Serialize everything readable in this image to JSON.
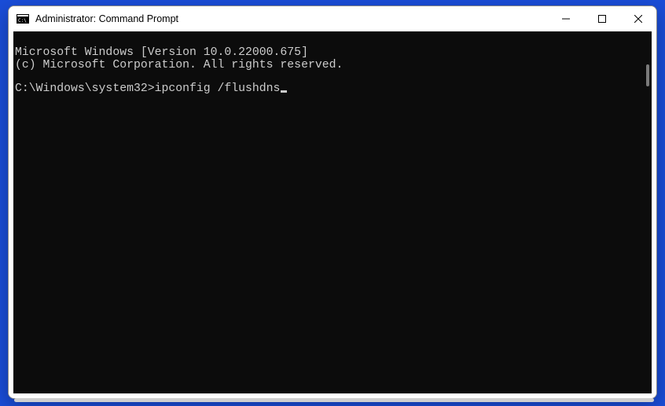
{
  "window": {
    "title": "Administrator: Command Prompt"
  },
  "terminal": {
    "line1": "Microsoft Windows [Version 10.0.22000.675]",
    "line2": "(c) Microsoft Corporation. All rights reserved.",
    "prompt": "C:\\Windows\\system32>",
    "command": "ipconfig /flushdns"
  }
}
